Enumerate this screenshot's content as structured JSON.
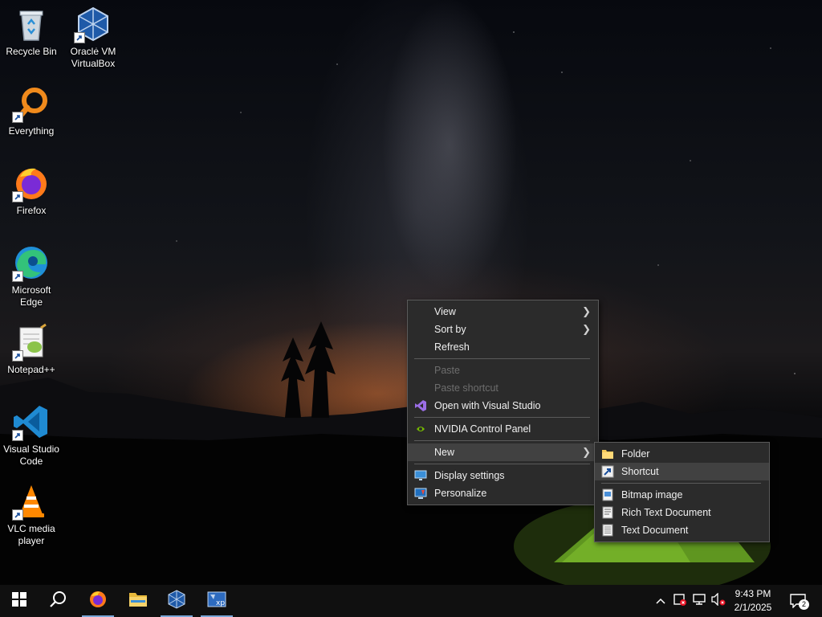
{
  "desktop": {
    "icons": [
      {
        "label_line1": "Recycle Bin",
        "label_line2": "",
        "icon": "recycle-bin-icon"
      },
      {
        "label_line1": "Oracle VM",
        "label_line2": "VirtualBox",
        "icon": "virtualbox-icon"
      },
      {
        "label_line1": "Everything",
        "label_line2": "",
        "icon": "everything-search-icon"
      },
      {
        "label_line1": "Firefox",
        "label_line2": "",
        "icon": "firefox-icon"
      },
      {
        "label_line1": "Microsoft",
        "label_line2": "Edge",
        "icon": "edge-icon"
      },
      {
        "label_line1": "Notepad++",
        "label_line2": "",
        "icon": "notepadpp-icon"
      },
      {
        "label_line1": "Visual Studio",
        "label_line2": "Code",
        "icon": "vscode-icon"
      },
      {
        "label_line1": "VLC media",
        "label_line2": "player",
        "icon": "vlc-icon"
      }
    ]
  },
  "context_menu": {
    "view": "View",
    "sort_by": "Sort by",
    "refresh": "Refresh",
    "paste": "Paste",
    "paste_shortcut": "Paste shortcut",
    "open_with_vs": "Open with Visual Studio",
    "nvidia": "NVIDIA Control Panel",
    "new": "New",
    "display_settings": "Display settings",
    "personalize": "Personalize"
  },
  "new_submenu": {
    "folder": "Folder",
    "shortcut": "Shortcut",
    "bitmap": "Bitmap image",
    "rich_text": "Rich Text Document",
    "text_doc": "Text Document"
  },
  "taskbar": {
    "start": "start-icon",
    "search": "search-icon",
    "pinned": [
      "firefox-icon",
      "file-explorer-icon",
      "virtualbox-icon",
      "xp-vm-icon"
    ],
    "tray": {
      "time": "9:43 PM",
      "date": "2/1/2025",
      "notification_count": "2"
    }
  },
  "colors": {
    "menu_bg": "#2b2b2b",
    "menu_highlight": "#414141",
    "taskbar_bg": "#101010",
    "accent": "#7aa7d8"
  }
}
